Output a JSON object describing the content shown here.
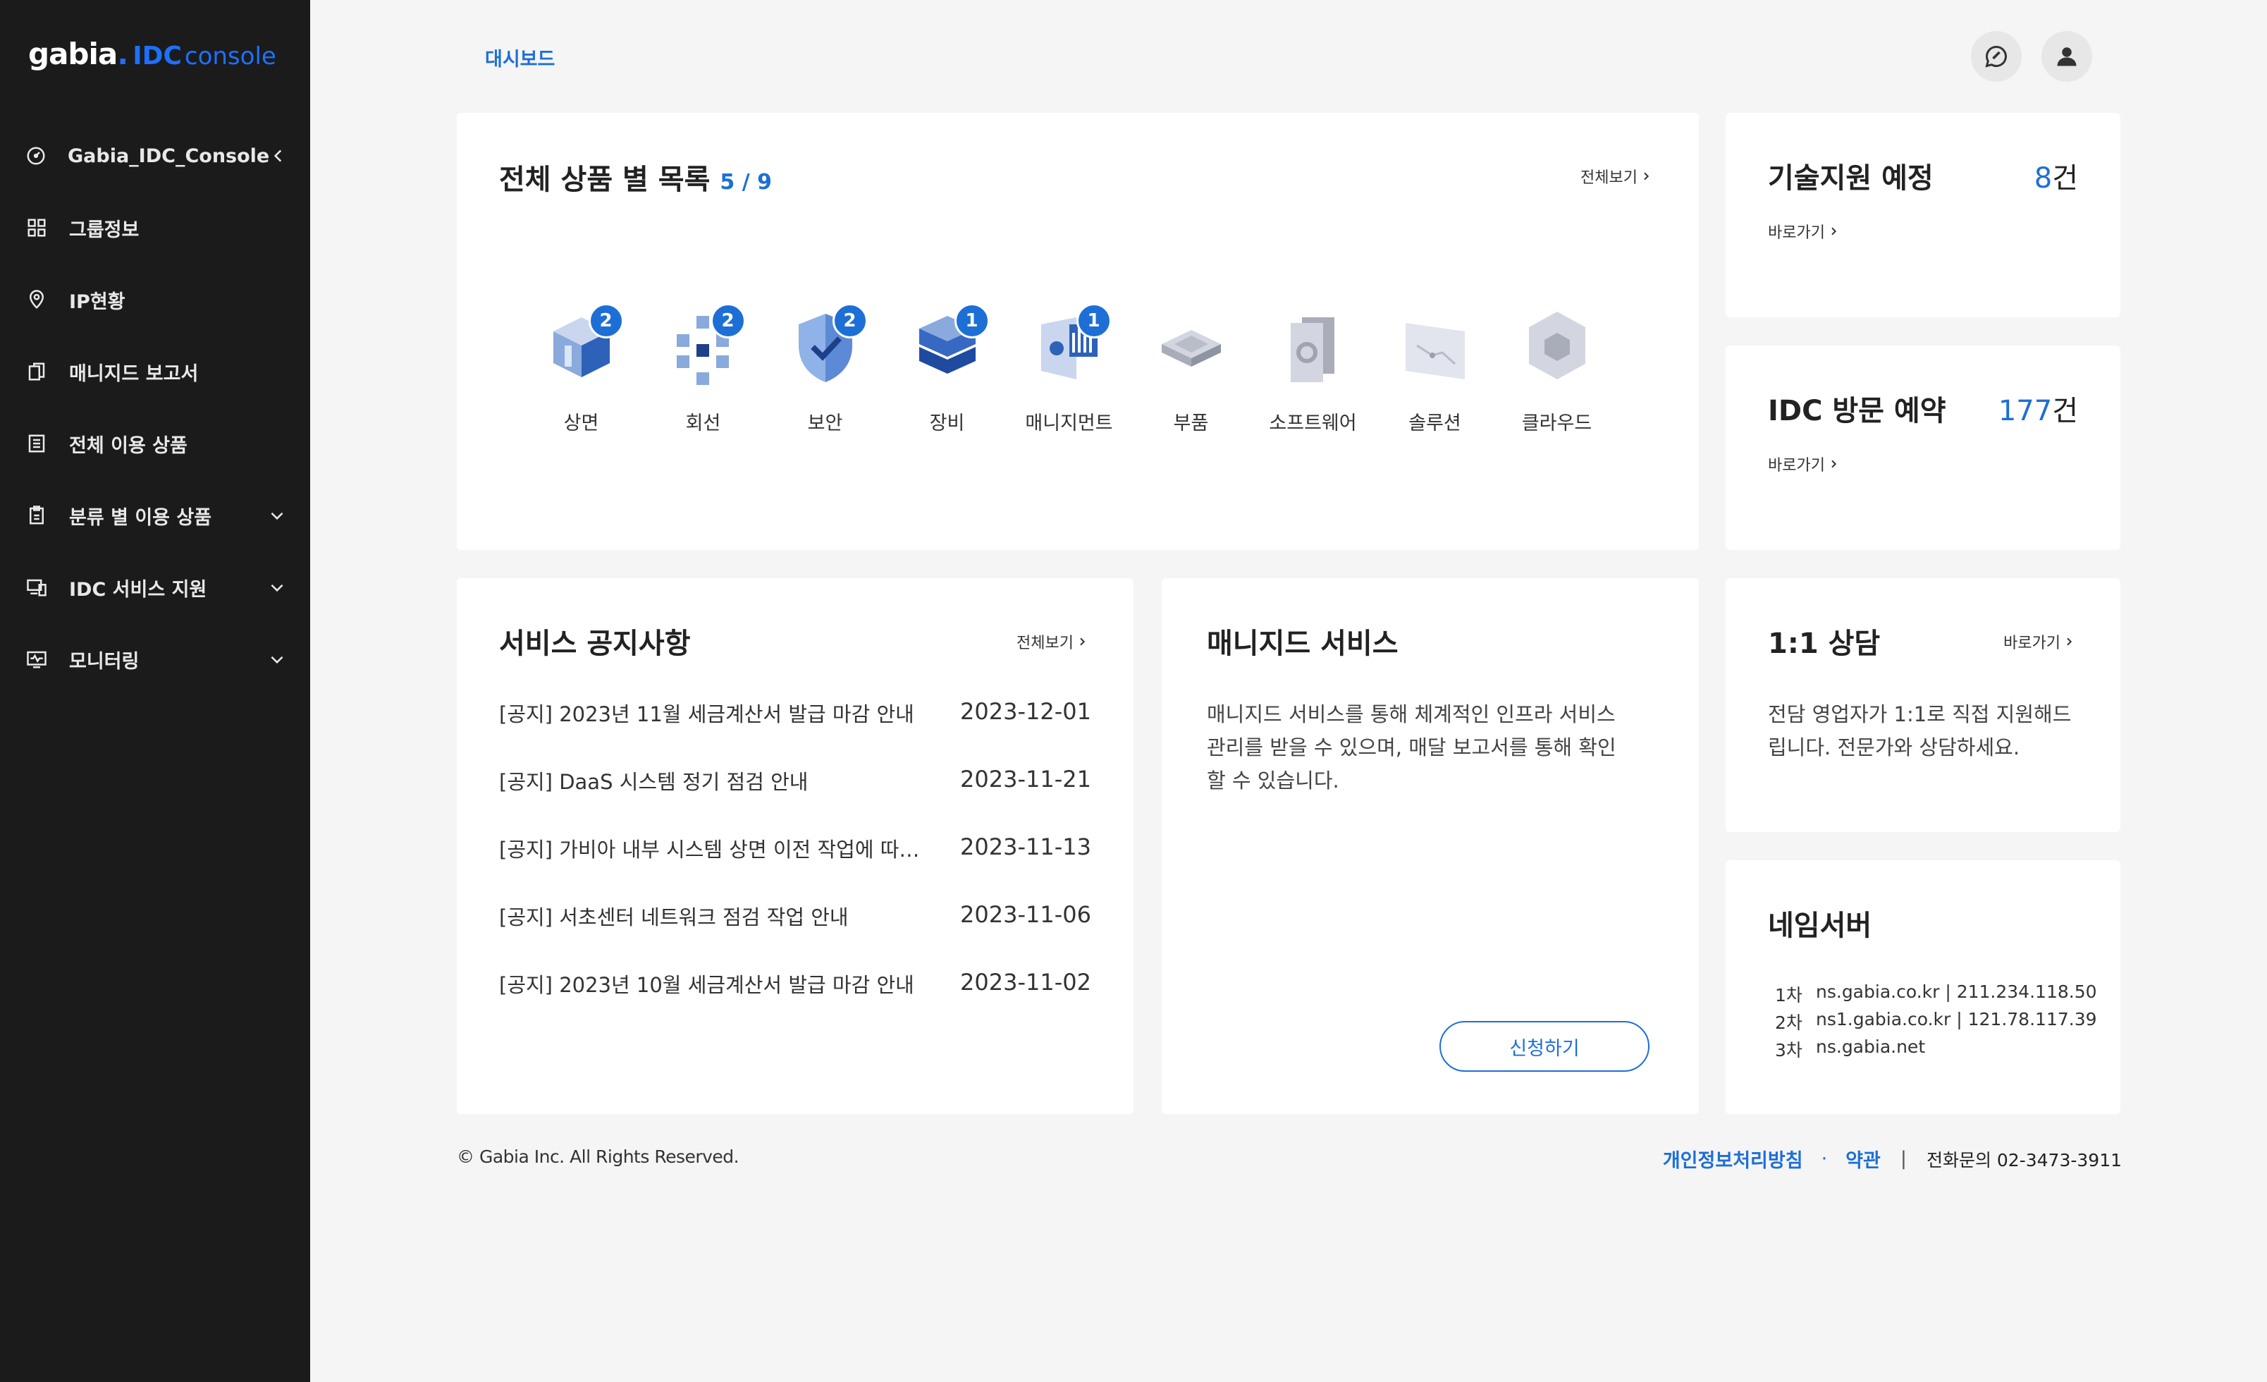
{
  "sidebar": {
    "logo": {
      "brand": "gabia",
      "dot": ".",
      "idc": "IDC",
      "console": "console"
    },
    "items": [
      {
        "label": "Gabia_IDC_Console",
        "icon": "dashboard-gauge-icon",
        "chevron": "left"
      },
      {
        "label": "그룹정보",
        "icon": "group-grid-icon",
        "chevron": ""
      },
      {
        "label": "IP현황",
        "icon": "location-pin-icon",
        "chevron": ""
      },
      {
        "label": "매니지드 보고서",
        "icon": "report-copy-icon",
        "chevron": ""
      },
      {
        "label": "전체 이용 상품",
        "icon": "list-document-icon",
        "chevron": ""
      },
      {
        "label": "분류 별 이용 상품",
        "icon": "clipboard-icon",
        "chevron": "down"
      },
      {
        "label": "IDC 서비스 지원",
        "icon": "devices-icon",
        "chevron": "down"
      },
      {
        "label": "모니터링",
        "icon": "monitor-pulse-icon",
        "chevron": "down"
      }
    ]
  },
  "header": {
    "title": "대시보드",
    "icons": [
      "feedback-chat-icon",
      "user-profile-icon"
    ]
  },
  "products_card": {
    "title": "전체 상품 별 목록",
    "count": "5 / 9",
    "more": "전체보기",
    "items": [
      {
        "label": "상면",
        "badge": "2",
        "icon": "colocation-rack-icon"
      },
      {
        "label": "회선",
        "badge": "2",
        "icon": "network-line-icon"
      },
      {
        "label": "보안",
        "badge": "2",
        "icon": "security-shield-icon"
      },
      {
        "label": "장비",
        "badge": "1",
        "icon": "equipment-stack-icon"
      },
      {
        "label": "매니지먼트",
        "badge": "1",
        "icon": "management-icon"
      },
      {
        "label": "부품",
        "badge": "",
        "icon": "parts-chip-icon"
      },
      {
        "label": "소프트웨어",
        "badge": "",
        "icon": "software-gear-icon"
      },
      {
        "label": "솔루션",
        "badge": "",
        "icon": "solution-graph-icon"
      },
      {
        "label": "클라우드",
        "badge": "",
        "icon": "cloud-cube-icon"
      }
    ]
  },
  "tech_support": {
    "title": "기술지원 예정",
    "value": "8",
    "unit": "건",
    "link": "바로가기"
  },
  "idc_visit": {
    "title": "IDC 방문 예약",
    "value": "177",
    "unit": "건",
    "link": "바로가기"
  },
  "notices": {
    "title": "서비스 공지사항",
    "more": "전체보기",
    "rows": [
      {
        "title": "[공지] 2023년 11월 세금계산서 발급 마감 안내",
        "date": "2023-12-01"
      },
      {
        "title": "[공지] DaaS 시스템 정기 점검 안내",
        "date": "2023-11-21"
      },
      {
        "title": "[공지] 가비아 내부 시스템 상면 이전 작업에 따른 서비스 일시 중단 안내",
        "date": "2023-11-13"
      },
      {
        "title": "[공지] 서초센터 네트워크 점검 작업 안내",
        "date": "2023-11-06"
      },
      {
        "title": "[공지] 2023년 10월 세금계산서 발급 마감 안내",
        "date": "2023-11-02"
      }
    ]
  },
  "managed": {
    "title": "매니지드 서비스",
    "desc_lines": [
      "매니지드 서비스를 통해 체계적인 인프라 서비스",
      "관리를 받을 수 있으며, 매달 보고서를 통해 확인",
      "할 수 있습니다."
    ],
    "button": "신청하기"
  },
  "consult": {
    "title": "1:1 상담",
    "link": "바로가기",
    "desc_lines": [
      "전담 영업자가 1:1로 직접 지원해드",
      "립니다. 전문가와 상담하세요."
    ]
  },
  "nameserver": {
    "title": "네임서버",
    "rows": [
      {
        "label": "1차",
        "value": "ns.gabia.co.kr | 211.234.118.50"
      },
      {
        "label": "2차",
        "value": "ns1.gabia.co.kr | 121.78.117.39"
      },
      {
        "label": "3차",
        "value": "ns.gabia.net"
      }
    ]
  },
  "footer": {
    "copyright": "© Gabia Inc. All Rights Reserved.",
    "privacy": "개인정보처리방침",
    "terms": "약관",
    "phone": "전화문의 02-3473-3911"
  },
  "colors": {
    "accent": "#1d6fd6",
    "sidebar": "#1b1b1b",
    "background": "#f5f5f5"
  }
}
